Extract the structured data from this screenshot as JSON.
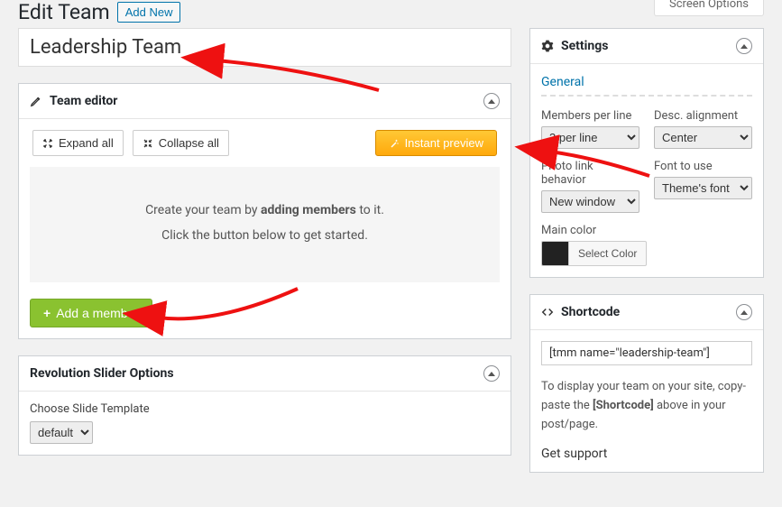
{
  "header": {
    "page_title": "Edit Team",
    "add_new_label": "Add New",
    "screen_options_label": "Screen Options"
  },
  "title_input": {
    "value": "Leadership Team"
  },
  "team_editor": {
    "panel_title": "Team editor",
    "expand_all_label": "Expand all",
    "collapse_all_label": "Collapse all",
    "instant_preview_label": "Instant preview",
    "placeholder_line1_prefix": "Create your team by ",
    "placeholder_line1_bold": "adding members",
    "placeholder_line1_suffix": " to it.",
    "placeholder_line2": "Click the button below to get started.",
    "add_member_label": "Add a member"
  },
  "rev_slider": {
    "panel_title": "Revolution Slider Options",
    "choose_label": "Choose Slide Template",
    "selected": "default"
  },
  "settings": {
    "panel_title": "Settings",
    "general_label": "General",
    "members_per_line": {
      "label": "Members per line",
      "value": "3 per line"
    },
    "desc_alignment": {
      "label": "Desc. alignment",
      "value": "Center"
    },
    "photo_link": {
      "label": "Photo link behavior",
      "value": "New window"
    },
    "font": {
      "label": "Font to use",
      "value": "Theme's font"
    },
    "main_color": {
      "label": "Main color",
      "button": "Select Color",
      "value": "#222222"
    }
  },
  "shortcode": {
    "panel_title": "Shortcode",
    "value": "[tmm name=\"leadership-team\"]",
    "help_prefix": "To display your team on your site, copy-paste the ",
    "help_bold": "[Shortcode]",
    "help_suffix": " above in your post/page.",
    "get_support": "Get support"
  }
}
